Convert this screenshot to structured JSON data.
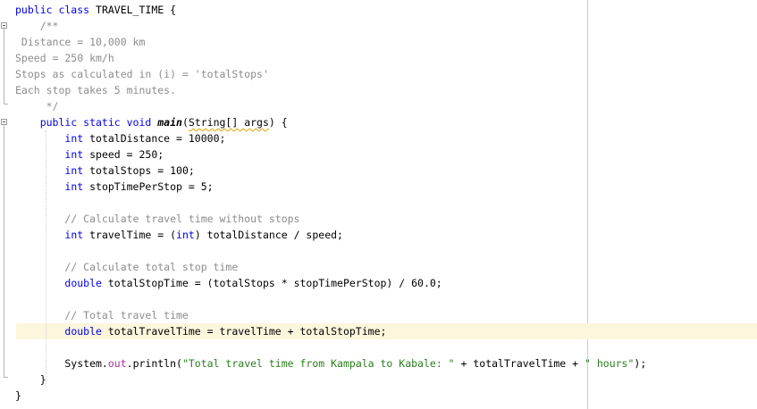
{
  "editor": {
    "lines": [
      {
        "segments": [
          {
            "t": "public class ",
            "c": "kw"
          },
          {
            "t": "TRAVEL_TIME {",
            "c": ""
          }
        ]
      },
      {
        "segments": [
          {
            "t": "    /**",
            "c": "cmt"
          }
        ]
      },
      {
        "segments": [
          {
            "t": " Distance = 10,000 km",
            "c": "cmt"
          }
        ]
      },
      {
        "segments": [
          {
            "t": "Speed = 250 km/h",
            "c": "cmt"
          }
        ]
      },
      {
        "segments": [
          {
            "t": "Stops as calculated in (i) = 'totalStops'",
            "c": "cmt"
          }
        ]
      },
      {
        "segments": [
          {
            "t": "Each stop takes 5 minutes.",
            "c": "cmt"
          }
        ]
      },
      {
        "segments": [
          {
            "t": "     */",
            "c": "cmt"
          }
        ]
      },
      {
        "segments": [
          {
            "t": "    public static void ",
            "c": "kw"
          },
          {
            "t": "main",
            "c": "mname"
          },
          {
            "t": "(",
            "c": ""
          },
          {
            "t": "String[] args",
            "c": "squig"
          },
          {
            "t": ") {",
            "c": ""
          }
        ]
      },
      {
        "segments": [
          {
            "t": "        ",
            "c": ""
          },
          {
            "t": "int",
            "c": "type"
          },
          {
            "t": " totalDistance = 10000;",
            "c": ""
          }
        ]
      },
      {
        "segments": [
          {
            "t": "        ",
            "c": ""
          },
          {
            "t": "int",
            "c": "type"
          },
          {
            "t": " speed = 250;",
            "c": ""
          }
        ]
      },
      {
        "segments": [
          {
            "t": "        ",
            "c": ""
          },
          {
            "t": "int",
            "c": "type"
          },
          {
            "t": " totalStops = 100;",
            "c": ""
          }
        ]
      },
      {
        "segments": [
          {
            "t": "        ",
            "c": ""
          },
          {
            "t": "int",
            "c": "type"
          },
          {
            "t": " stopTimePerStop = 5;",
            "c": ""
          }
        ]
      },
      {
        "segments": []
      },
      {
        "segments": [
          {
            "t": "        // Calculate travel time without stops",
            "c": "cmt"
          }
        ]
      },
      {
        "segments": [
          {
            "t": "        ",
            "c": ""
          },
          {
            "t": "int",
            "c": "type"
          },
          {
            "t": " travelTime = (",
            "c": ""
          },
          {
            "t": "int",
            "c": "type"
          },
          {
            "t": ") totalDistance / speed;",
            "c": ""
          }
        ]
      },
      {
        "segments": []
      },
      {
        "segments": [
          {
            "t": "        // Calculate total stop time",
            "c": "cmt"
          }
        ]
      },
      {
        "segments": [
          {
            "t": "        ",
            "c": ""
          },
          {
            "t": "double",
            "c": "type"
          },
          {
            "t": " totalStopTime = (totalStops * stopTimePerStop) / 60.0;",
            "c": ""
          }
        ]
      },
      {
        "segments": []
      },
      {
        "segments": [
          {
            "t": "        // Total travel time",
            "c": "cmt"
          }
        ]
      },
      {
        "segments": [
          {
            "t": "        ",
            "c": ""
          },
          {
            "t": "double",
            "c": "type"
          },
          {
            "t": " totalTravelTime = travelTime + totalStopTime;",
            "c": ""
          }
        ]
      },
      {
        "segments": []
      },
      {
        "segments": [
          {
            "t": "        System.",
            "c": ""
          },
          {
            "t": "out",
            "c": "fld"
          },
          {
            "t": ".println(",
            "c": ""
          },
          {
            "t": "\"Total travel time from Kampala to Kabale: \"",
            "c": "str"
          },
          {
            "t": " + totalTravelTime + ",
            "c": ""
          },
          {
            "t": "\" hours\"",
            "c": "str"
          },
          {
            "t": ");",
            "c": ""
          }
        ]
      },
      {
        "segments": [
          {
            "t": "    }",
            "c": ""
          }
        ]
      },
      {
        "segments": [
          {
            "t": "}",
            "c": ""
          }
        ]
      }
    ]
  }
}
